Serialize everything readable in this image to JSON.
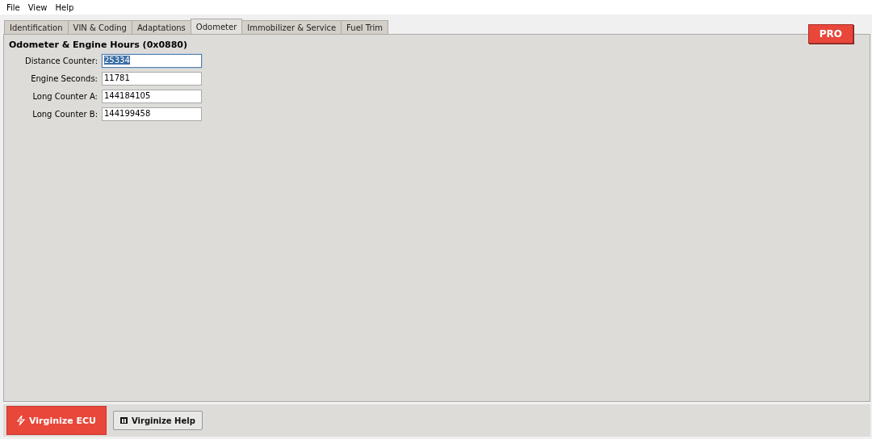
{
  "menu": [
    "File",
    "View",
    "Help"
  ],
  "tabs": [
    {
      "label": "Identification",
      "selected": false
    },
    {
      "label": "VIN & Coding",
      "selected": false
    },
    {
      "label": "Adaptations",
      "selected": false
    },
    {
      "label": "Odometer",
      "selected": true
    },
    {
      "label": "Immobilizer & Service",
      "selected": false
    },
    {
      "label": "Fuel Trim",
      "selected": false
    }
  ],
  "pro_badge": "PRO",
  "section_title": "Odometer & Engine Hours (0x0880)",
  "fields": [
    {
      "label": "Distance Counter:",
      "value": "25334",
      "focused": true
    },
    {
      "label": "Engine Seconds:",
      "value": "11781",
      "focused": false
    },
    {
      "label": "Long Counter A:",
      "value": "144184105",
      "focused": false
    },
    {
      "label": "Long Counter B:",
      "value": "144199458",
      "focused": false
    }
  ],
  "buttons": [
    {
      "label": "Virginize ECU",
      "kind": "primary"
    },
    {
      "label": "Virginize Help",
      "kind": "secondary"
    }
  ]
}
